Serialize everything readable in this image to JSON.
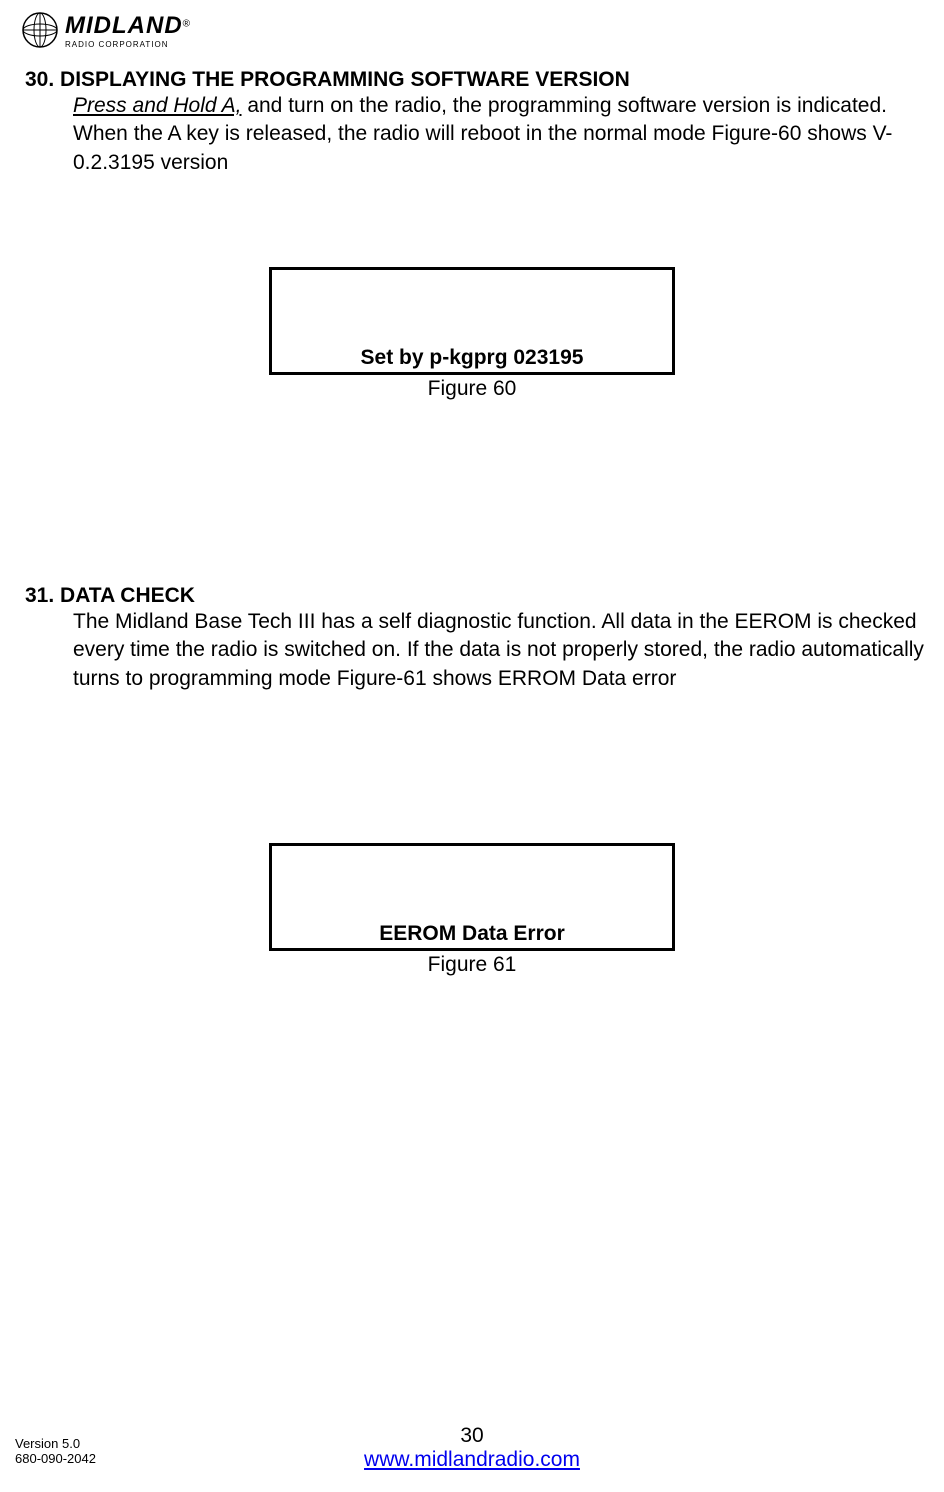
{
  "logo": {
    "main": "MIDLAND",
    "sub": "RADIO CORPORATION"
  },
  "section30": {
    "heading": "30. DISPLAYING THE PROGRAMMING SOFTWARE VERSION",
    "pressHold": "Press and Hold A,",
    "body1": "  and turn on the radio, the programming software version is indicated. When the A key is released, the radio will reboot in the normal mode Figure-60 shows V-0.2.3195 version",
    "displayText": "Set by p-kgprg 023195",
    "figureCaption": "Figure 60"
  },
  "section31": {
    "heading": "31. DATA CHECK",
    "body": "The Midland Base Tech III has a self diagnostic function. All data in the EEROM is checked every time the radio is switched on. If the data is not properly stored, the radio automatically turns to programming mode Figure-61 shows ERROM Data error",
    "displayText": "EEROM    Data Error",
    "figureCaption": "Figure 61"
  },
  "footer": {
    "pageNumber": "30",
    "link": "www.midlandradio.com",
    "version": "Version 5.0",
    "partNumber": "680-090-2042"
  }
}
